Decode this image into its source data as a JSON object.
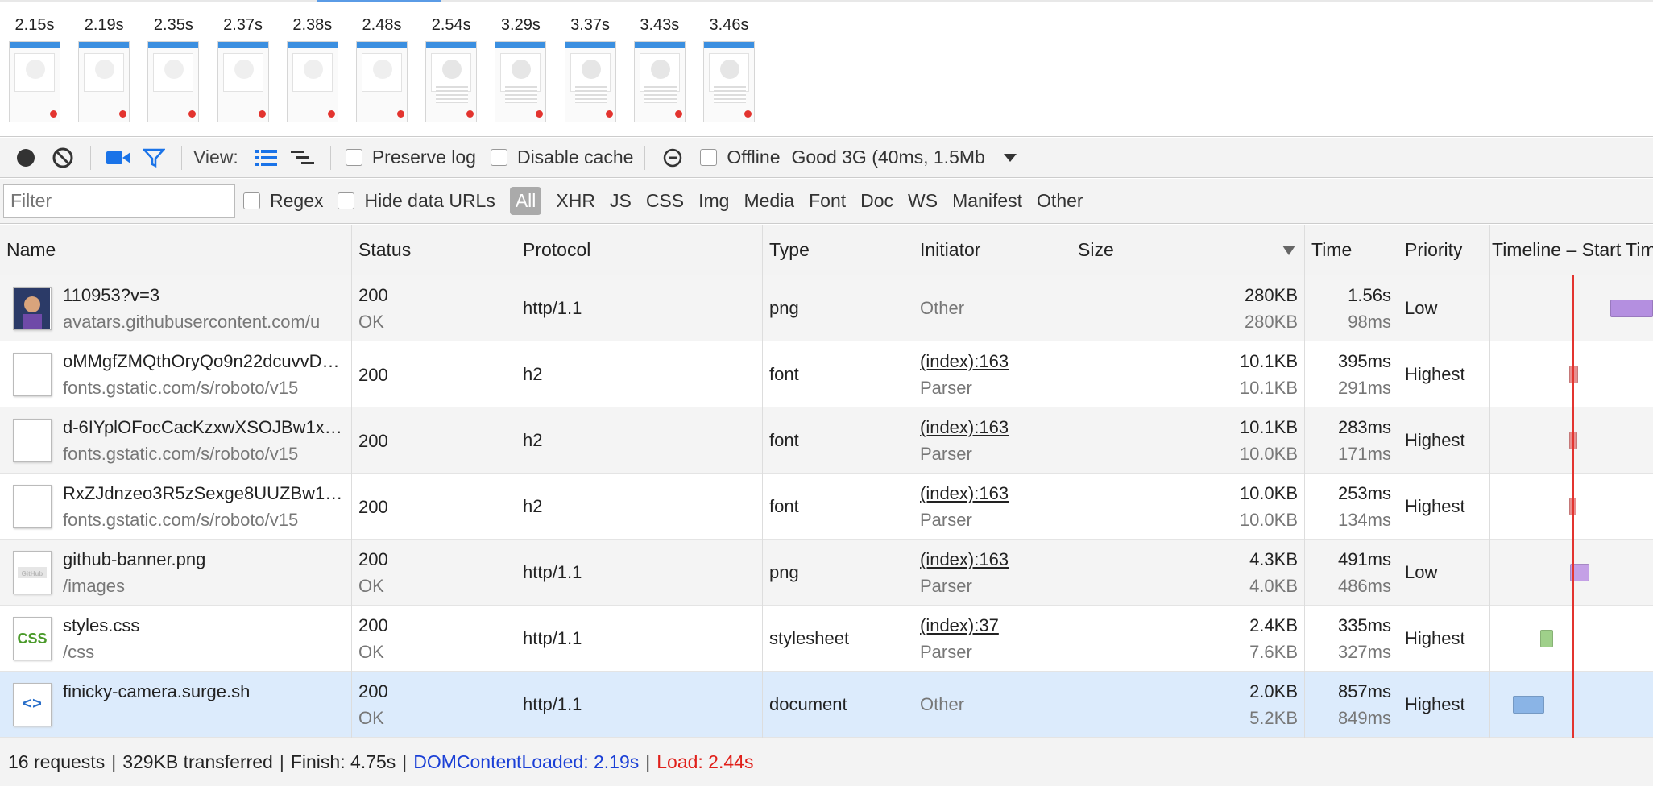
{
  "filmstrip": {
    "frames": [
      "2.15s",
      "2.19s",
      "2.35s",
      "2.37s",
      "2.38s",
      "2.48s",
      "2.54s",
      "3.29s",
      "3.37s",
      "3.43s",
      "3.46s"
    ]
  },
  "toolbar": {
    "view_label": "View:",
    "preserve_log": "Preserve log",
    "disable_cache": "Disable cache",
    "offline": "Offline",
    "throttle": "Good 3G (40ms, 1.5Mb"
  },
  "filterbar": {
    "placeholder": "Filter",
    "regex": "Regex",
    "hide_data_urls": "Hide data URLs",
    "types": [
      "All",
      "XHR",
      "JS",
      "CSS",
      "Img",
      "Media",
      "Font",
      "Doc",
      "WS",
      "Manifest",
      "Other"
    ]
  },
  "columns": {
    "name": "Name",
    "status": "Status",
    "protocol": "Protocol",
    "type": "Type",
    "initiator": "Initiator",
    "size": "Size",
    "time": "Time",
    "priority": "Priority",
    "timeline": "Timeline – Start Time"
  },
  "rows": [
    {
      "name": "110953?v=3",
      "host": "avatars.githubusercontent.com/u",
      "status": "200",
      "status_text": "OK",
      "protocol": "http/1.1",
      "type": "png",
      "initiator": "Other",
      "initiator_sub": "",
      "size": "280KB",
      "size2": "280KB",
      "time": "1.56s",
      "latency": "98ms",
      "priority": "Low",
      "icon": "avatar",
      "bar_color": "#b48fe0",
      "bar_start": 0.74,
      "bar_end": 1.0
    },
    {
      "name": "oMMgfZMQthOryQo9n22dcuvvD…",
      "host": "fonts.gstatic.com/s/roboto/v15",
      "status": "200",
      "status_text": "",
      "protocol": "h2",
      "type": "font",
      "initiator": "(index):163",
      "initiator_sub": "Parser",
      "size": "10.1KB",
      "size2": "10.1KB",
      "time": "395ms",
      "latency": "291ms",
      "priority": "Highest",
      "icon": "blank",
      "bar_color": "#e88f8f",
      "bar_start": 0.485,
      "bar_end": 0.54
    },
    {
      "name": "d-6IYplOFocCacKzxwXSOJBw1x…",
      "host": "fonts.gstatic.com/s/roboto/v15",
      "status": "200",
      "status_text": "",
      "protocol": "h2",
      "type": "font",
      "initiator": "(index):163",
      "initiator_sub": "Parser",
      "size": "10.1KB",
      "size2": "10.0KB",
      "time": "283ms",
      "latency": "171ms",
      "priority": "Highest",
      "icon": "blank",
      "bar_color": "#e88f8f",
      "bar_start": 0.485,
      "bar_end": 0.535
    },
    {
      "name": "RxZJdnzeo3R5zSexge8UUZBw1…",
      "host": "fonts.gstatic.com/s/roboto/v15",
      "status": "200",
      "status_text": "",
      "protocol": "h2",
      "type": "font",
      "initiator": "(index):163",
      "initiator_sub": "Parser",
      "size": "10.0KB",
      "size2": "10.0KB",
      "time": "253ms",
      "latency": "134ms",
      "priority": "Highest",
      "icon": "blank",
      "bar_color": "#e88f8f",
      "bar_start": 0.485,
      "bar_end": 0.53
    },
    {
      "name": "github-banner.png",
      "host": "/images",
      "status": "200",
      "status_text": "OK",
      "protocol": "http/1.1",
      "type": "png",
      "initiator": "(index):163",
      "initiator_sub": "Parser",
      "size": "4.3KB",
      "size2": "4.0KB",
      "time": "491ms",
      "latency": "486ms",
      "priority": "Low",
      "icon": "image",
      "bar_color": "#c4a0e6",
      "bar_start": 0.49,
      "bar_end": 0.61
    },
    {
      "name": "styles.css",
      "host": "/css",
      "status": "200",
      "status_text": "OK",
      "protocol": "http/1.1",
      "type": "stylesheet",
      "initiator": "(index):37",
      "initiator_sub": "Parser",
      "size": "2.4KB",
      "size2": "7.6KB",
      "time": "335ms",
      "latency": "327ms",
      "priority": "Highest",
      "icon": "css",
      "bar_color": "#9fd08a",
      "bar_start": 0.305,
      "bar_end": 0.385
    },
    {
      "name": "finicky-camera.surge.sh",
      "host": "",
      "status": "200",
      "status_text": "OK",
      "protocol": "http/1.1",
      "type": "document",
      "initiator": "Other",
      "initiator_sub": "",
      "size": "2.0KB",
      "size2": "5.2KB",
      "time": "857ms",
      "latency": "849ms",
      "priority": "Highest",
      "icon": "html",
      "bar_color": "#8ab4e6",
      "bar_start": 0.14,
      "bar_end": 0.33
    }
  ],
  "timeline": {
    "load_marker": 0.505
  },
  "statusbar": {
    "requests": "16 requests",
    "transferred": "329KB transferred",
    "finish": "Finish: 4.75s",
    "domcontentloaded": "DOMContentLoaded: 2.19s",
    "load": "Load: 2.44s"
  },
  "colors": {
    "accent": "#3b8fe0",
    "load": "#e0201a",
    "dcl": "#1a3fd6",
    "selected_row": "#dcebfc"
  }
}
